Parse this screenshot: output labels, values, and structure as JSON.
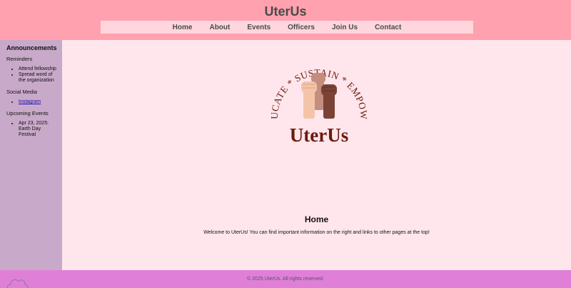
{
  "header": {
    "site_title": "UterUs",
    "nav": [
      "Home",
      "About",
      "Events",
      "Officers",
      "Join Us",
      "Contact"
    ]
  },
  "sidebar": {
    "title": "Announcements",
    "sections": [
      {
        "label": "Reminders",
        "items": [
          "Attend fellowship",
          "Spread word of the organization"
        ]
      },
      {
        "label": "Social Media",
        "items": [
          "Instagram"
        ]
      },
      {
        "label": "Upcoming Events",
        "items": [
          "Apr 23, 2025: Earth Day Festival"
        ]
      }
    ]
  },
  "logo": {
    "arc_text": "EDUCATE * SUSTAIN * EMPOWER",
    "wordmark": "UterUs"
  },
  "main": {
    "title": "Home",
    "welcome": "Welcome to UterUs! You can find important information on the right and links to other pages at the top!"
  },
  "footer": {
    "text": "© 2025 UterUs. All rights reserved."
  },
  "colors": {
    "header_bg": "#ffa1ae",
    "nav_bg": "#ffd6dd",
    "sidebar_bg": "#c9a9c9",
    "main_bg": "#ffe6ec",
    "footer_bg": "#e07fd8",
    "logo_brown": "#6b1a0a"
  },
  "icons": [
    "raised-fists-icon",
    "cloud-icon"
  ]
}
